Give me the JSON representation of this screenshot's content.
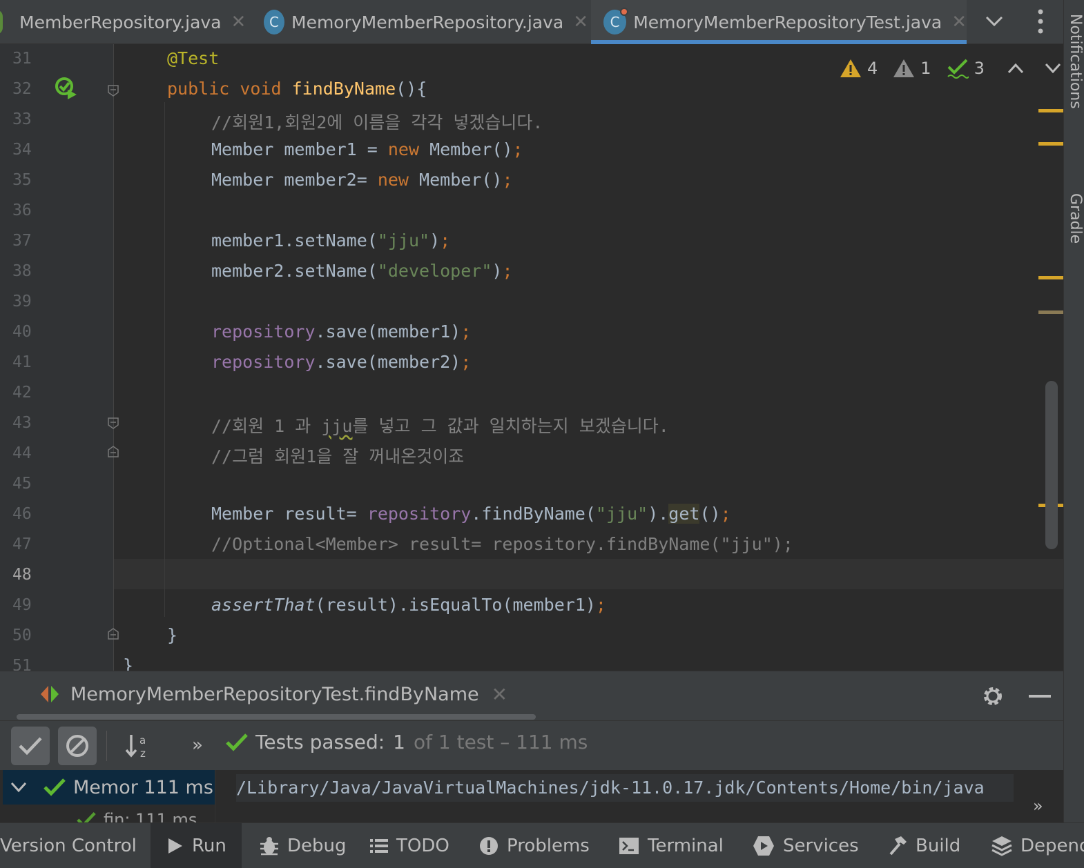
{
  "tabs": [
    {
      "label": "MemberRepository.java",
      "icon": "interface-icon"
    },
    {
      "label": "MemoryMemberRepository.java",
      "icon": "class-icon",
      "icon_letter": "C"
    },
    {
      "label": "MemoryMemberRepositoryTest.java",
      "icon": "test-class-icon",
      "icon_letter": "C",
      "active": true
    }
  ],
  "tab_close_glyph": "✕",
  "side_panels": [
    "Notifications",
    "Gradle"
  ],
  "inspections": {
    "warnings": "4",
    "weak_warnings": "1",
    "ok": "3"
  },
  "editor": {
    "line_numbers": [
      "31",
      "32",
      "33",
      "34",
      "35",
      "36",
      "37",
      "38",
      "39",
      "40",
      "41",
      "42",
      "43",
      "44",
      "45",
      "46",
      "47",
      "48",
      "49",
      "50",
      "51"
    ],
    "current_line": "48",
    "lines": {
      "l31": {
        "annotation": "@Test"
      },
      "l32": {
        "kw": "public void ",
        "fn": "findByName",
        "rest": "(){"
      },
      "l33": {
        "comment": "//회원1,회원2에 이름을 각각 넣겠습니다."
      },
      "l34": {
        "a": "Member member1 = ",
        "kw": "new",
        "b": " Member()",
        "semi": ";"
      },
      "l35": {
        "a": "Member member2= ",
        "kw": "new",
        "b": " Member()",
        "semi": ";"
      },
      "l37": {
        "a": "member1.setName(",
        "str": "\"jju\"",
        "b": ")",
        "semi": ";"
      },
      "l38": {
        "a": "member2.setName(",
        "str": "\"developer\"",
        "b": ")",
        "semi": ";"
      },
      "l40": {
        "field": "repository",
        "b": ".save(member1)",
        "semi": ";"
      },
      "l41": {
        "field": "repository",
        "b": ".save(member2)",
        "semi": ";"
      },
      "l43": {
        "c1": "//회원 1 과 ",
        "c2": "jju",
        "c3": "를 넣고 그 값과 일치하는지 보겠습니다."
      },
      "l44": {
        "comment": "//그럼 회원1을 잘 꺼내온것이죠"
      },
      "l46": {
        "a": "Member result= ",
        "field": "repository",
        "b": ".findByName(",
        "str": "\"jju\"",
        "c": ").",
        "hl": "get",
        "d": "()",
        "semi": ";"
      },
      "l47": {
        "comment": "//Optional<Member> result= repository.findByName(\"jju\");"
      },
      "l49": {
        "itl": "assertThat",
        "b": "(result).isEqualTo(member1)",
        "semi": ";"
      },
      "l50": {
        "text": "}"
      },
      "l51": {
        "text": "}"
      }
    }
  },
  "run": {
    "tab_label": "MemoryMemberRepositoryTest.findByName",
    "status_prefix": "Tests passed:",
    "status_passed": "1",
    "status_rest": "of 1 test – 111 ms",
    "more_glyph": "»",
    "tree_root": "Memor 111 ms",
    "tree_child": "fin: 111 ms",
    "console_text": "/Library/Java/JavaVirtualMachines/jdk-11.0.17.jdk/Contents/Home/bin/java"
  },
  "bottom_bar": {
    "version_control": "Version Control",
    "run": "Run",
    "debug": "Debug",
    "todo": "TODO",
    "problems": "Problems",
    "terminal": "Terminal",
    "services": "Services",
    "build": "Build",
    "dependencies": "Dependencies"
  },
  "colors": {
    "keyword": "#cc7832",
    "annotation": "#bbb529",
    "function": "#ffc66d",
    "string": "#6a8759",
    "comment": "#808080",
    "field": "#9876aa",
    "pass_green": "#5fb832",
    "warning": "#d6a52a",
    "accent_blue": "#4a88c7"
  }
}
